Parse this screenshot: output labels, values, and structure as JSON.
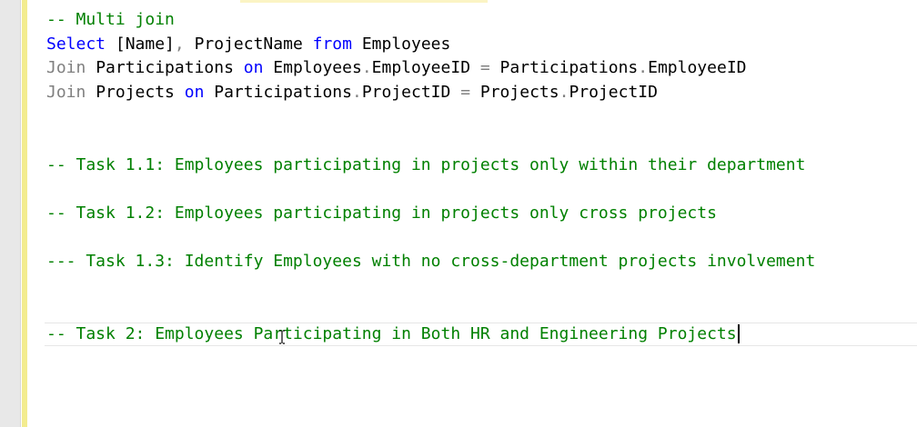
{
  "editor": {
    "lines": [
      {
        "segments": [
          {
            "type": "comment",
            "text": "-- Multi join"
          }
        ]
      },
      {
        "segments": [
          {
            "type": "kw",
            "text": "Select"
          },
          {
            "type": "txt",
            "text": " [Name]"
          },
          {
            "type": "op",
            "text": ","
          },
          {
            "type": "txt",
            "text": " ProjectName "
          },
          {
            "type": "kw",
            "text": "from"
          },
          {
            "type": "txt",
            "text": " Employees"
          }
        ]
      },
      {
        "segments": [
          {
            "type": "op",
            "text": "Join"
          },
          {
            "type": "txt",
            "text": " Participations "
          },
          {
            "type": "kw",
            "text": "on"
          },
          {
            "type": "txt",
            "text": " Employees"
          },
          {
            "type": "op",
            "text": "."
          },
          {
            "type": "txt",
            "text": "EmployeeID "
          },
          {
            "type": "op",
            "text": "="
          },
          {
            "type": "txt",
            "text": " Participations"
          },
          {
            "type": "op",
            "text": "."
          },
          {
            "type": "txt",
            "text": "EmployeeID"
          }
        ]
      },
      {
        "segments": [
          {
            "type": "op",
            "text": "Join"
          },
          {
            "type": "txt",
            "text": " Projects "
          },
          {
            "type": "kw",
            "text": "on"
          },
          {
            "type": "txt",
            "text": " Participations"
          },
          {
            "type": "op",
            "text": "."
          },
          {
            "type": "txt",
            "text": "ProjectID "
          },
          {
            "type": "op",
            "text": "="
          },
          {
            "type": "txt",
            "text": " Projects"
          },
          {
            "type": "op",
            "text": "."
          },
          {
            "type": "txt",
            "text": "ProjectID"
          }
        ]
      },
      {
        "segments": []
      },
      {
        "segments": []
      },
      {
        "segments": [
          {
            "type": "comment",
            "text": "-- Task 1.1: Employees participating in projects only within their department"
          }
        ]
      },
      {
        "segments": []
      },
      {
        "segments": [
          {
            "type": "comment",
            "text": "-- Task 1.2: Employees participating in projects only cross projects"
          }
        ]
      },
      {
        "segments": []
      },
      {
        "segments": [
          {
            "type": "comment",
            "text": "--- Task 1.3: Identify Employees with no cross-department projects involvement"
          }
        ]
      },
      {
        "segments": []
      },
      {
        "segments": []
      },
      {
        "segments": [
          {
            "type": "comment",
            "text": "-- Task 2: Employees Participating in Both HR and Engineering Projects"
          }
        ],
        "current": true
      }
    ]
  }
}
